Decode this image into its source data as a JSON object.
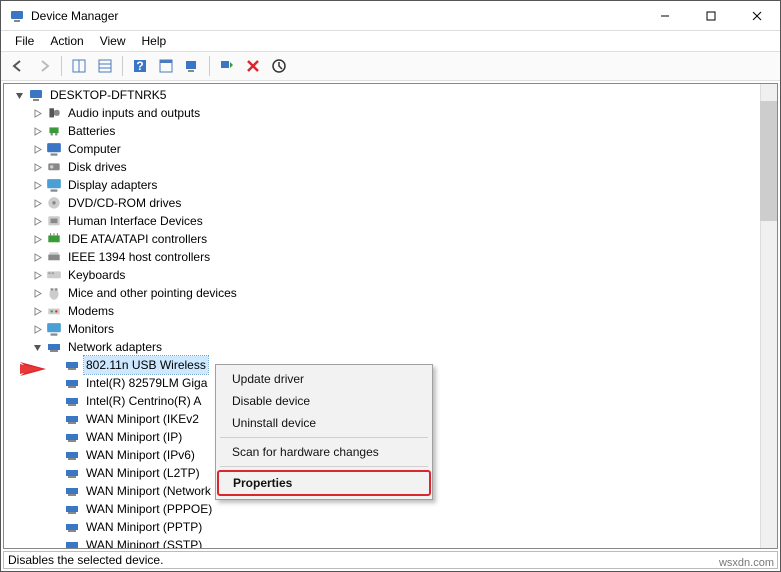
{
  "window": {
    "title": "Device Manager"
  },
  "menubar": [
    "File",
    "Action",
    "View",
    "Help"
  ],
  "root": "DESKTOP-DFTNRK5",
  "categories": [
    "Audio inputs and outputs",
    "Batteries",
    "Computer",
    "Disk drives",
    "Display adapters",
    "DVD/CD-ROM drives",
    "Human Interface Devices",
    "IDE ATA/ATAPI controllers",
    "IEEE 1394 host controllers",
    "Keyboards",
    "Mice and other pointing devices",
    "Modems",
    "Monitors"
  ],
  "expanded_category": "Network adapters",
  "adapters": [
    "802.11n USB Wireless",
    "Intel(R) 82579LM Giga",
    "Intel(R) Centrino(R) A",
    "WAN Miniport (IKEv2",
    "WAN Miniport (IP)",
    "WAN Miniport (IPv6)",
    "WAN Miniport (L2TP)",
    "WAN Miniport (Network Monitor)",
    "WAN Miniport (PPPOE)",
    "WAN Miniport (PPTP)",
    "WAN Miniport (SSTP)"
  ],
  "context_menu": {
    "items": [
      "Update driver",
      "Disable device",
      "Uninstall device",
      "Scan for hardware changes",
      "Properties"
    ]
  },
  "statusbar": "Disables the selected device.",
  "watermark": "wsxdn.com",
  "icons": {
    "app": "device-manager-icon",
    "minimize": "minimize-icon",
    "maximize": "maximize-icon",
    "close": "close-icon",
    "back": "back-icon",
    "forward": "forward-icon",
    "list": "show-hidden-icon",
    "details": "details-icon",
    "help": "help-icon",
    "props": "properties-icon",
    "refresh": "scan-icon",
    "update": "update-driver-icon",
    "delete": "uninstall-icon",
    "more": "legacy-icon"
  }
}
